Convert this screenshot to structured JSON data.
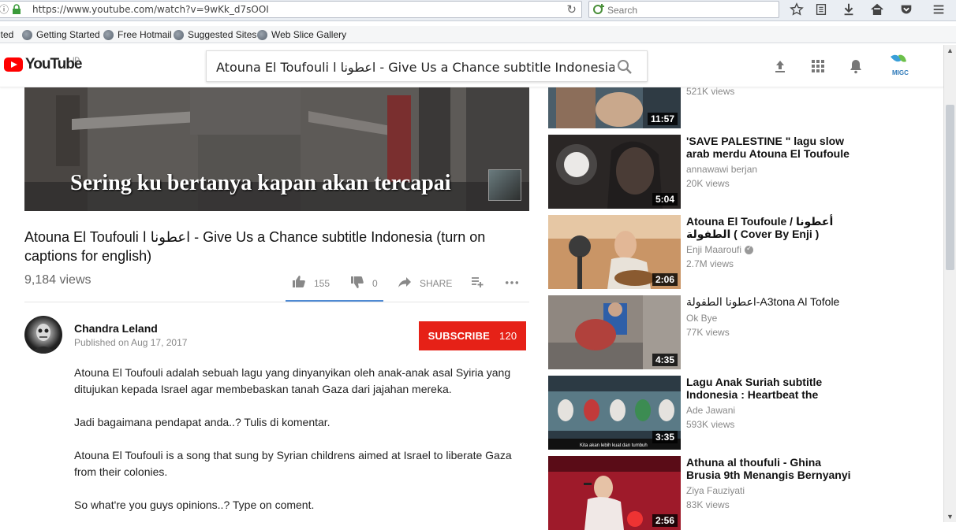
{
  "browser": {
    "url": "https://www.youtube.com/watch?v=9wKk_d7sOOI",
    "search_placeholder": "Search"
  },
  "bookmarks": [
    {
      "label": "ited"
    },
    {
      "label": "Getting Started"
    },
    {
      "label": "Free Hotmail"
    },
    {
      "label": "Suggested Sites"
    },
    {
      "label": "Web Slice Gallery"
    }
  ],
  "youtube": {
    "logo_text": "YouTube",
    "country": "ID",
    "search_value": "Atouna El Toufouli اعطونا ا - Give Us a Chance subtitle Indonesia (turn on",
    "avatar_text": "MIGC"
  },
  "player": {
    "subtitle": "Sering ku bertanya kapan akan tercapai"
  },
  "video": {
    "title": "Atouna El Toufouli اعطونا ا - Give Us a Chance subtitle Indonesia (turn on captions for english)",
    "views": "9,184 views",
    "likes": "155",
    "dislikes": "0",
    "share": "SHARE"
  },
  "owner": {
    "name": "Chandra Leland",
    "published": "Published on Aug 17, 2017",
    "subscribe_label": "SUBSCRIBE",
    "subscriber_count": "120"
  },
  "description": [
    "Atouna El Toufouli adalah sebuah lagu yang dinyanyikan oleh anak-anak asal Syiria yang ditujukan kepada Israel agar membebaskan tanah Gaza dari jajahan mereka.",
    "Jadi bagaimana pendapat anda..? Tulis di komentar.",
    "Atouna El Toufouli is a song that sung by Syrian childrens aimed at Israel to liberate Gaza from their colonies.",
    "So what're you guys opinions..? Type on coment."
  ],
  "related": [
    {
      "title": "",
      "channel": "",
      "views": "521K views",
      "duration": "11:57",
      "verified": false
    },
    {
      "title": "'SAVE PALESTINE \" lagu slow arab merdu Atouna El Toufoule",
      "channel": "annawawi berjan",
      "views": "20K views",
      "duration": "5:04",
      "verified": false
    },
    {
      "title": "Atouna El Toufoule / أعطونا الطفولة ( Cover By Enji )",
      "channel": "Enji Maaroufi",
      "views": "2.7M views",
      "duration": "2:06",
      "verified": true
    },
    {
      "title": "اعطونا الطفولة-A3tona Al Tofole",
      "channel": "Ok Bye",
      "views": "77K views",
      "duration": "4:35",
      "verified": false
    },
    {
      "title": "Lagu Anak Suriah subtitle Indonesia : Heartbeat the",
      "channel": "Ade Jawani",
      "views": "593K views",
      "duration": "3:35",
      "verified": false
    },
    {
      "title": "Athuna al thoufuli - Ghina Brusia 9th Menangis Bernyanyi",
      "channel": "Ziya Fauziyati",
      "views": "83K views",
      "duration": "2:56",
      "verified": false
    }
  ],
  "thumb_caption": "Kita akan lebih kuat dan tumbuh",
  "colors": {
    "subscribe": "#e62117",
    "youtube_red": "#ff0000",
    "like_underline": "#4f8ad3"
  }
}
